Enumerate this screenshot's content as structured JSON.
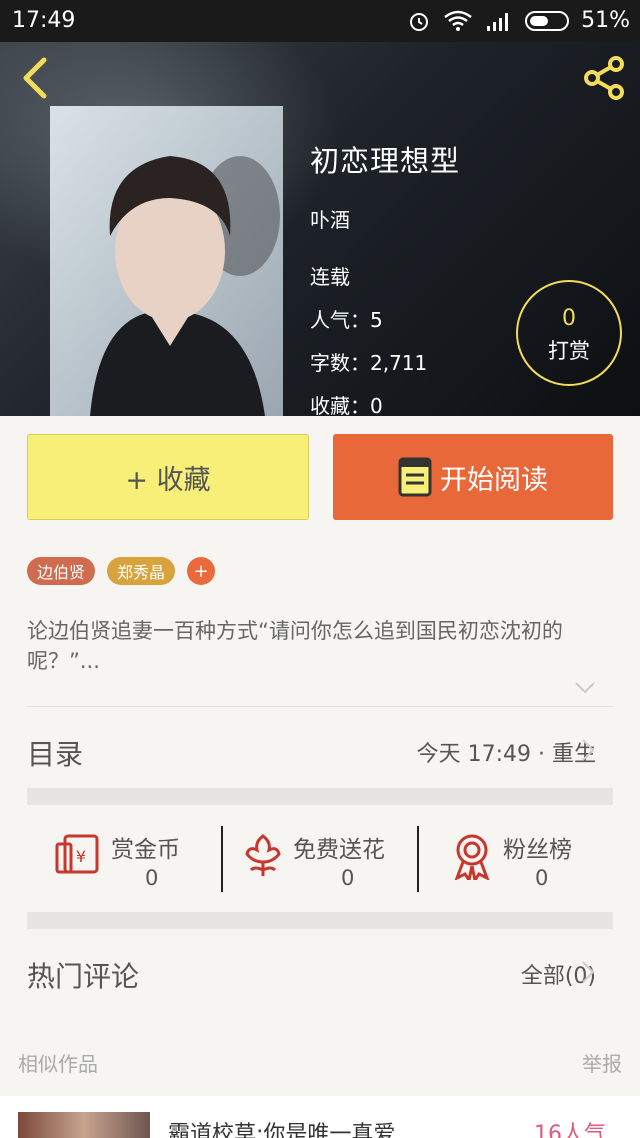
{
  "status_bar": {
    "time": "17:49",
    "battery": "51%"
  },
  "hero": {
    "title": "初恋理想型",
    "author": "卟酒",
    "status": "连载",
    "popularity": "人气：5",
    "word_count": "字数：2,711",
    "favorites": "收藏：0",
    "reward_count": "0",
    "reward_label": "打赏"
  },
  "actions": {
    "favorite_label": "+ 收藏",
    "read_label": "开始阅读"
  },
  "tags": [
    "边伯贤",
    "郑秀晶"
  ],
  "tag_add": "+",
  "description": "论边伯贤追妻一百种方式“请问你怎么追到国民初恋沈初的呢？”...",
  "catalog": {
    "title": "目录",
    "latest": "今天 17:49 · 重生"
  },
  "stats": [
    {
      "label": "赏金币",
      "value": "0",
      "icon": "coin-envelope-icon"
    },
    {
      "label": "免费送花",
      "value": "0",
      "icon": "flower-icon"
    },
    {
      "label": "粉丝榜",
      "value": "0",
      "icon": "medal-icon"
    }
  ],
  "comments": {
    "title": "热门评论",
    "all_label": "全部(0)"
  },
  "similar": {
    "title": "相似作品",
    "report": "举报"
  },
  "similar_item": {
    "title": "霸道校草:你是唯一真爱",
    "popularity": "16人气"
  },
  "colors": {
    "accent_orange": "#e8683a",
    "favorite_yellow": "#f8ef78",
    "icon_red": "#c8372d"
  }
}
